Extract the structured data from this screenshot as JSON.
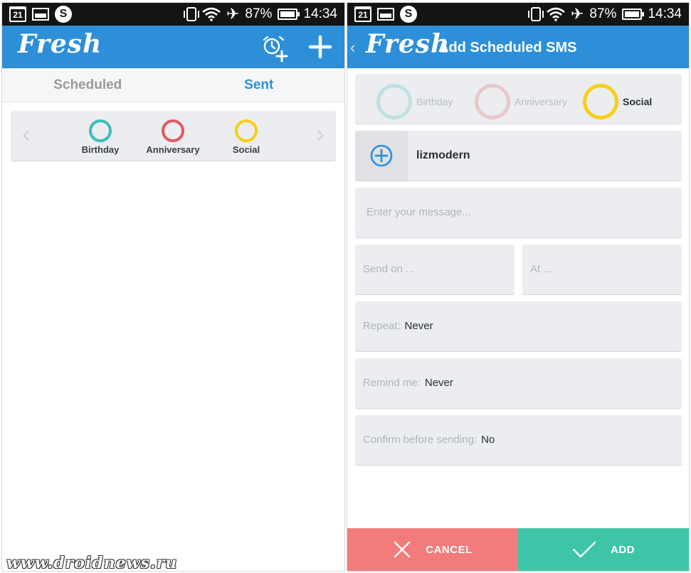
{
  "status_bar": {
    "date_badge": "21",
    "battery": "87%",
    "time": "14:34"
  },
  "icons": {
    "date": "calendar-icon",
    "gallery": "gallery-icon",
    "app": "s-app-icon",
    "vibrate": "vibrate-icon",
    "wifi": "wifi-icon",
    "airplane": "airplane-icon",
    "battery": "battery-icon",
    "alarm_add": "alarm-add-icon",
    "add": "plus-icon",
    "back": "chevron-left-icon",
    "contact_add": "plus-circle-icon",
    "cancel": "close-icon",
    "confirm": "check-icon"
  },
  "colors": {
    "brand_blue": "#2d8fd8",
    "birthday": "#3bbdbc",
    "anniversary": "#e05a5e",
    "social": "#f7cf16",
    "cancel": "#f27b7b",
    "add": "#3ec4a6"
  },
  "left": {
    "logo": "Fresh",
    "tabs": [
      {
        "label": "Scheduled"
      },
      {
        "label": "Sent"
      }
    ],
    "filter": {
      "categories": [
        {
          "label": "Birthday"
        },
        {
          "label": "Anniversary"
        },
        {
          "label": "Social"
        }
      ]
    }
  },
  "right": {
    "logo": "Fresh",
    "title": "Add Scheduled SMS",
    "categories": [
      {
        "label": "Birthday",
        "selected": false
      },
      {
        "label": "Anniversary",
        "selected": false
      },
      {
        "label": "Social",
        "selected": true
      }
    ],
    "contact": "lizmodern",
    "message_placeholder": "Enter your message...",
    "send_on_placeholder": "Send on ...",
    "at_placeholder": "At ...",
    "repeat": {
      "label": "Repeat:",
      "value": "Never"
    },
    "remind": {
      "label": "Remind me:",
      "value": "Never"
    },
    "confirm": {
      "label": "Confirm before sending:",
      "value": "No"
    },
    "cancel_label": "CANCEL",
    "add_label": "ADD"
  },
  "watermark": "www.droidnews.ru"
}
